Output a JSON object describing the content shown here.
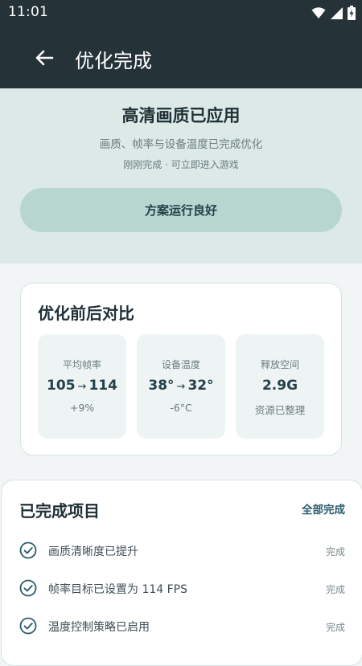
{
  "status_bar": {
    "time": "11:01",
    "icons": [
      "wifi-icon",
      "signal-icon",
      "battery-charging-icon"
    ]
  },
  "app_bar": {
    "title": "优化完成",
    "back_icon": "arrow-left-icon"
  },
  "hero": {
    "title": "高清画质已应用",
    "subtitle": "画质、帧率与设备温度已完成优化",
    "meta": "刚刚完成 · 可立即进入游戏",
    "button_label": "方案运行良好"
  },
  "compare": {
    "title": "优化前后对比",
    "stats": [
      {
        "label": "平均帧率",
        "before": "105",
        "after": "114",
        "arrow": "→",
        "note": "+9%"
      },
      {
        "label": "设备温度",
        "before": "38°",
        "after": "32°",
        "arrow": "→",
        "note": "-6°C"
      },
      {
        "label": "释放空间",
        "value": "2.9G",
        "note": "资源已整理"
      }
    ]
  },
  "completed": {
    "title": "已完成项目",
    "all_label": "全部完成",
    "items": [
      {
        "text": "画质清晰度已提升",
        "status": "完成"
      },
      {
        "text": "帧率目标已设置为 114 FPS",
        "status": "完成"
      },
      {
        "text": "温度控制策略已启用",
        "status": "完成"
      }
    ]
  },
  "colors": {
    "header": "#253339",
    "accent": "#2b5a6b",
    "hero_bg": "#dce9e6",
    "button_bg": "#b7d6d0"
  }
}
